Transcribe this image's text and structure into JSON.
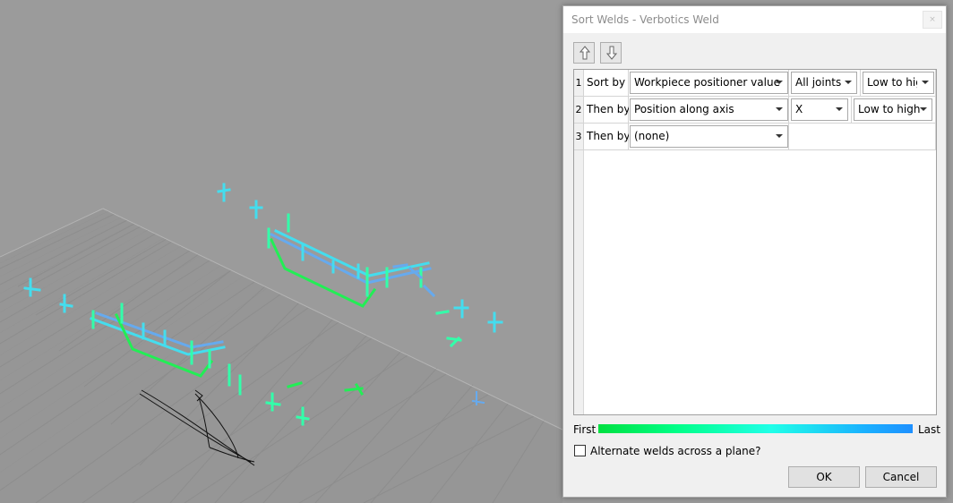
{
  "dialog": {
    "title": "Sort Welds - Verbotics Weld",
    "close_glyph": "×",
    "move_up_icon": "arrow-up-icon",
    "move_down_icon": "arrow-down-icon"
  },
  "sort_rows": [
    {
      "index": "1",
      "label": "Sort by",
      "criterion": "Workpiece positioner value",
      "scope": "All joints",
      "order": "Low to high"
    },
    {
      "index": "2",
      "label": "Then by",
      "criterion": "Position along axis",
      "scope": "X",
      "order": "Low to high"
    },
    {
      "index": "3",
      "label": "Then by",
      "criterion": "(none)"
    }
  ],
  "legend": {
    "first_label": "First",
    "last_label": "Last",
    "gradient_colors": [
      "#00e040",
      "#00ff88",
      "#20ffe8",
      "#1e90ff"
    ]
  },
  "alternate_checkbox": {
    "label": "Alternate welds across a plane?",
    "checked": false
  },
  "buttons": {
    "ok": "OK",
    "cancel": "Cancel"
  },
  "viewport": {
    "background_color": "#9b9b9b",
    "grid_color": "#8f8f8f",
    "weld_colors": [
      "#22ee55",
      "#33ffaa",
      "#44ddee",
      "#66aaee"
    ]
  }
}
